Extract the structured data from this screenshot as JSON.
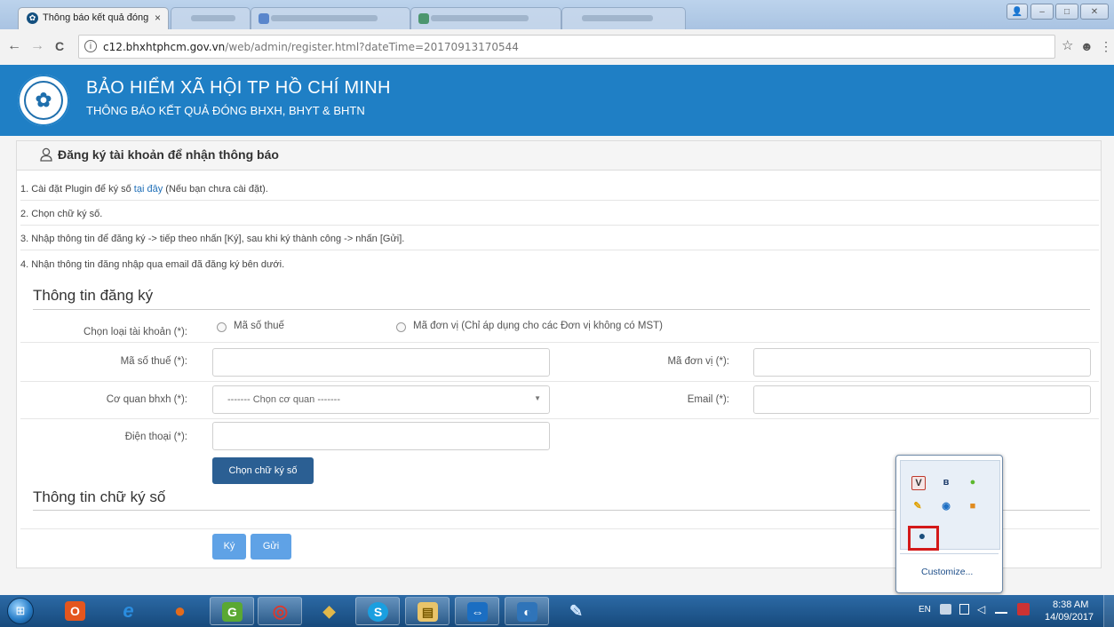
{
  "browser": {
    "active_tab": {
      "title": "Thông báo kết quả đóng",
      "close": "×"
    },
    "window_controls": {
      "minimize": "–",
      "maximize": "□",
      "close": "✕",
      "profile": "👤"
    },
    "nav": {
      "back": "←",
      "forward": "→",
      "reload": "C",
      "info": "i"
    },
    "url_host": "c12.bhxhtphcm.gov.vn",
    "url_path": "/web/admin/register.html?dateTime=20170913170544",
    "star": "☆",
    "ext": "☻",
    "menu": "⋮"
  },
  "site": {
    "title": "BẢO HIỂM XÃ HỘI TP HỒ CHÍ MINH",
    "subtitle": "THÔNG BÁO KẾT QUẢ ĐÓNG BHXH, BHYT & BHTN",
    "logo_glyph": "✿"
  },
  "panel": {
    "title": "Đăng ký tài khoản để nhận thông báo",
    "steps": {
      "s1_prefix": "1. Cài đặt Plugin để ký số ",
      "s1_link": "tại đây",
      "s1_suffix": " (Nếu bạn chưa cài đặt).",
      "s2": "2. Chọn chữ ký số.",
      "s3": "3. Nhập thông tin để đăng ký -> tiếp theo nhấn [Ký], sau khi ký thành công -> nhấn [Gửi].",
      "s4": "4. Nhận thông tin đăng nhập qua email đã đăng ký bên dưới."
    }
  },
  "form": {
    "section_title": "Thông tin đăng ký",
    "account_type_label": "Chọn loại tài khoản (*):",
    "radio_tax": "Mã số thuế",
    "radio_unit": "Mã đơn vị (Chỉ áp dụng cho các Đơn vị không có MST)",
    "tax_label": "Mã số thuế (*):",
    "unit_label": "Mã đơn vị (*):",
    "agency_label": "Cơ quan bhxh (*):",
    "agency_selected": "------- Chọn cơ quan -------",
    "agency_arrow": "▼",
    "email_label": "Email (*):",
    "phone_label": "Điện thoại (*):",
    "choose_signature_button": "Chọn chữ ký số"
  },
  "signature": {
    "section_title": "Thông tin chữ ký số",
    "sign_button": "Ký",
    "send_button": "Gửi"
  },
  "tray_popup": {
    "icons": [
      {
        "name": "v-icon",
        "glyph": "V",
        "color": "#c0392b"
      },
      {
        "name": "bluetooth-icon",
        "glyph": "ʙ",
        "color": "#1b3a6a"
      },
      {
        "name": "evernote-icon",
        "glyph": "●",
        "color": "#5cb82e"
      },
      {
        "name": "tools-icon",
        "glyph": "✎",
        "color": "#e0a000"
      },
      {
        "name": "teamviewer-tray-icon",
        "glyph": "◉",
        "color": "#1d6fc4"
      },
      {
        "name": "app-orange-icon",
        "glyph": "■",
        "color": "#e08a1e"
      },
      {
        "name": "bhxh-plugin-icon",
        "glyph": "●",
        "color": "#1a4e7c"
      }
    ],
    "customize": "Customize..."
  },
  "taskbar": {
    "start_glyph": "⊞",
    "apps": [
      {
        "name": "office-icon",
        "glyph": "O",
        "color": "#e4561e",
        "state": "pinned"
      },
      {
        "name": "internet-explorer-icon",
        "glyph": "e",
        "color": "#2a8de0",
        "state": "pinned"
      },
      {
        "name": "firefox-icon",
        "glyph": "●",
        "color": "#e36b1c",
        "state": "pinned"
      },
      {
        "name": "coccoc-icon",
        "glyph": "G",
        "color": "#5aa833",
        "state": "running"
      },
      {
        "name": "chrome-icon",
        "glyph": "◎",
        "color": "#d93a2e",
        "state": "running"
      },
      {
        "name": "folder-share-icon",
        "glyph": "◆",
        "color": "#e2b84a",
        "state": "pinned"
      },
      {
        "name": "skype-icon",
        "glyph": "S",
        "color": "#1a9fe0",
        "state": "running"
      },
      {
        "name": "file-explorer-icon",
        "glyph": "▤",
        "color": "#e9c46a",
        "state": "running"
      },
      {
        "name": "teamviewer-icon",
        "glyph": "⇔",
        "color": "#1b6ec2",
        "state": "running"
      },
      {
        "name": "viewer-icon",
        "glyph": "◐",
        "color": "#2f74b9",
        "state": "running"
      },
      {
        "name": "paint-icon",
        "glyph": "✎",
        "color": "#3b8bd0",
        "state": "pinned"
      }
    ],
    "lang": "EN",
    "time": "8:38 AM",
    "date": "14/09/2017"
  }
}
